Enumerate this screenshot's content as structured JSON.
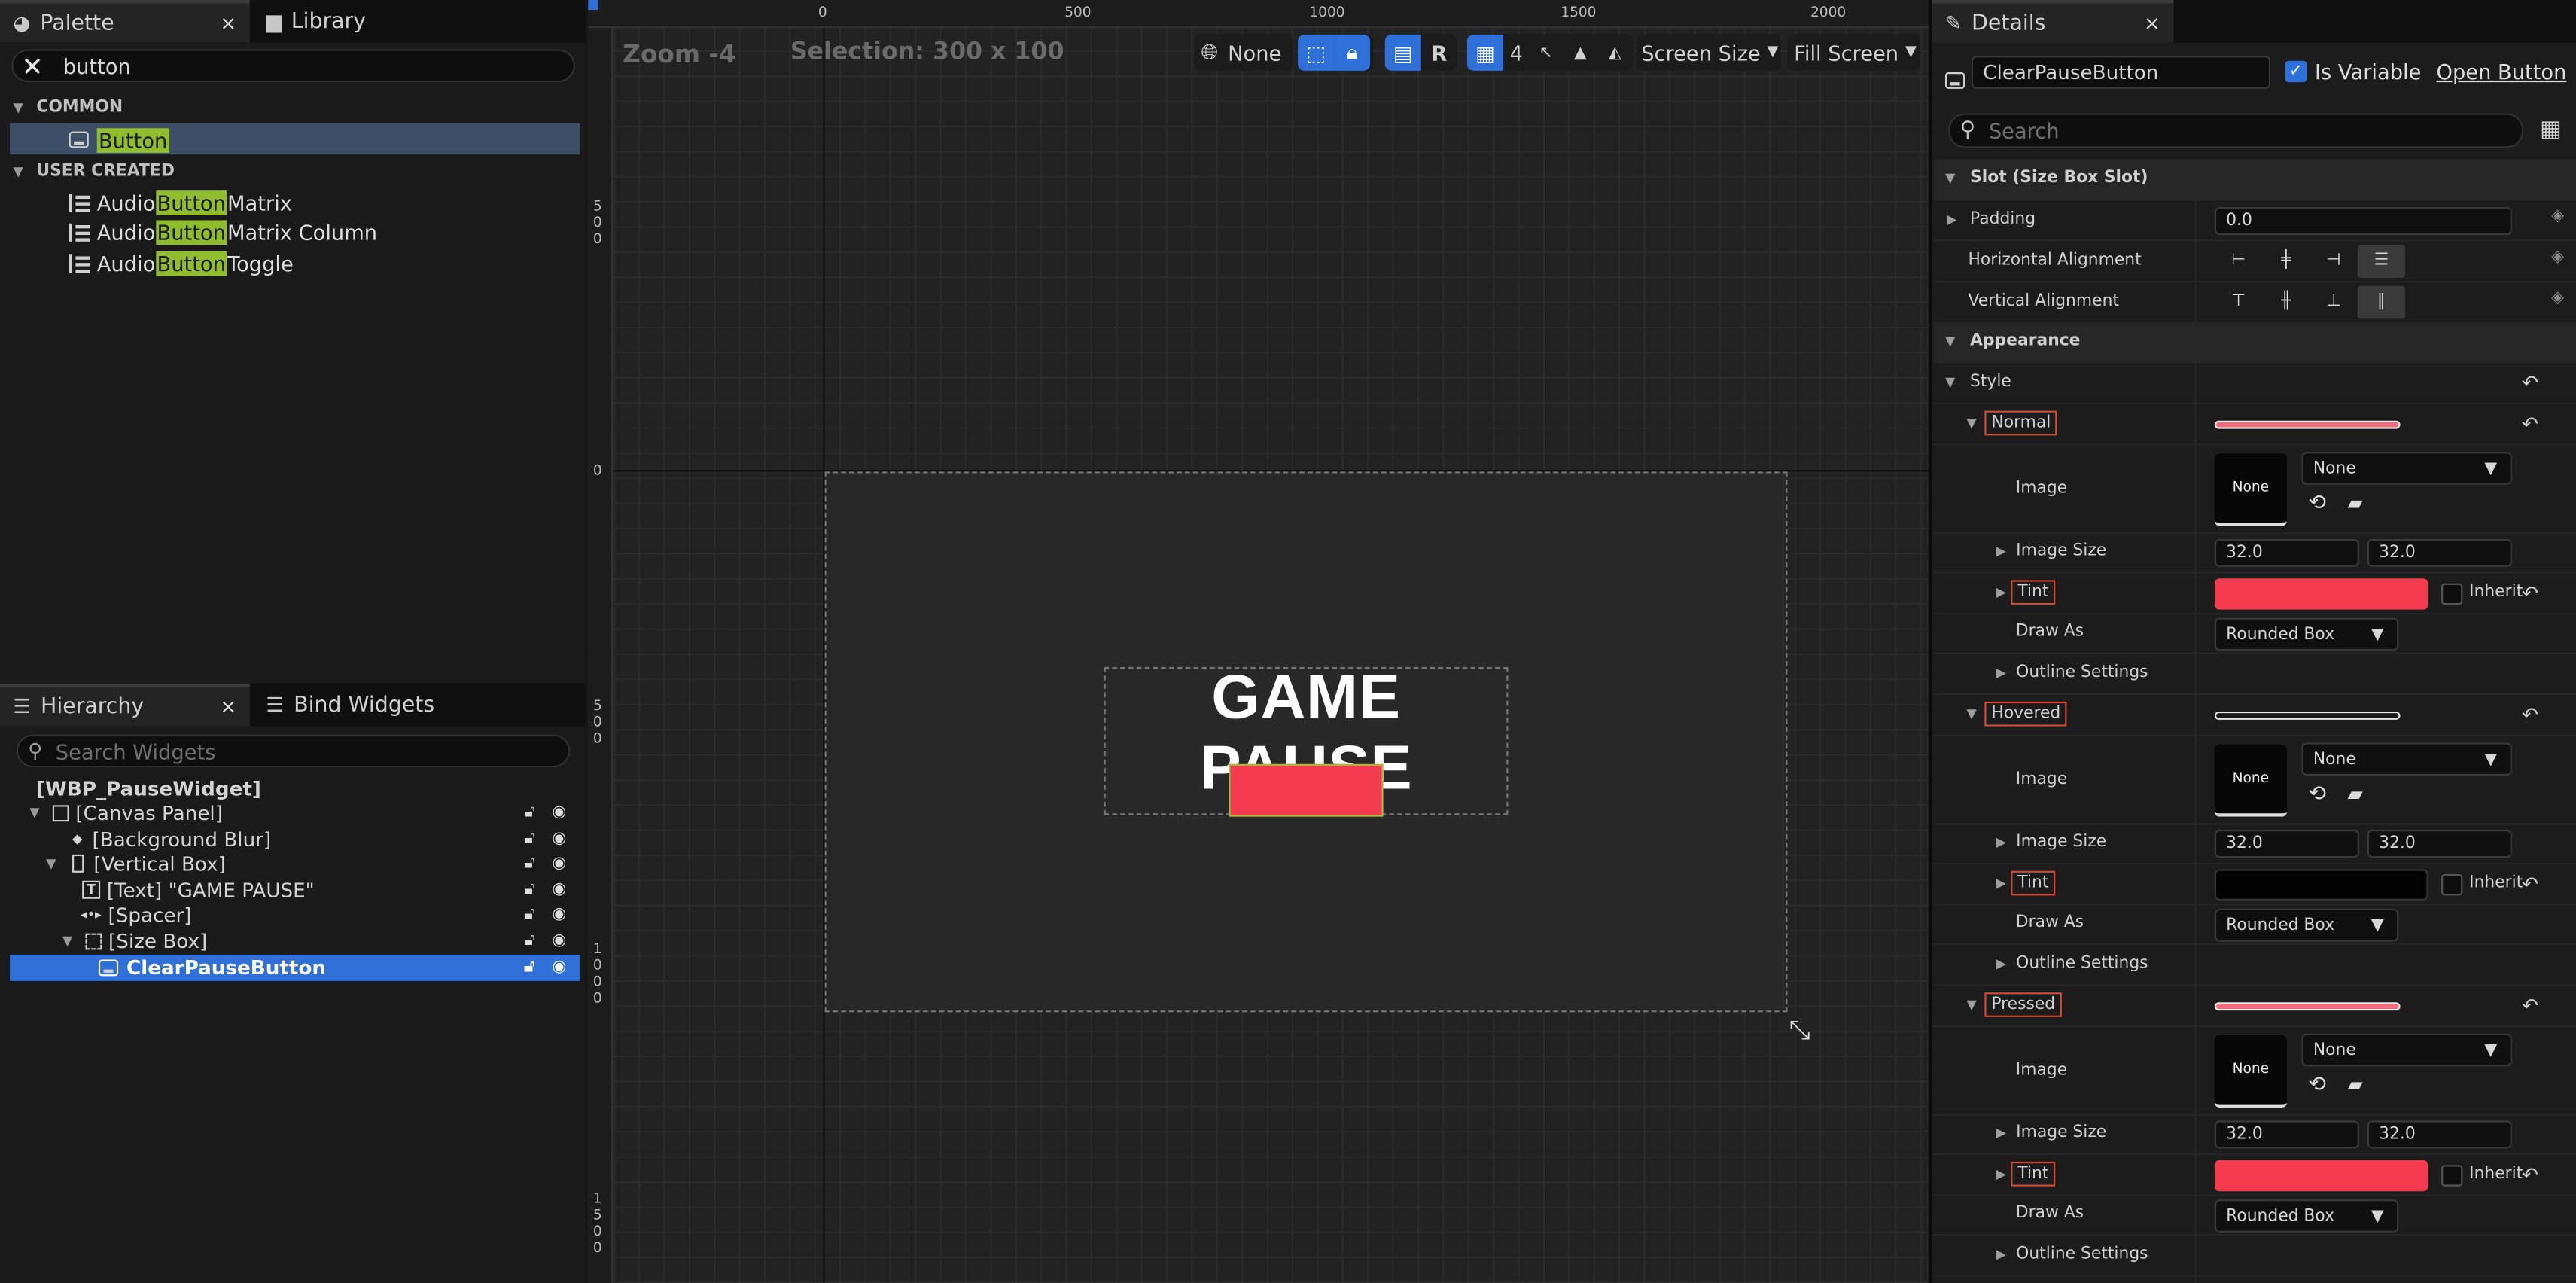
{
  "palette": {
    "tab_label": "Palette",
    "library_tab_label": "Library",
    "close_glyph": "×",
    "search_value": "button",
    "categories": [
      {
        "label": "COMMON",
        "items": [
          {
            "prefix": "",
            "match": "Button",
            "suffix": ""
          }
        ]
      },
      {
        "label": "USER CREATED",
        "items": [
          {
            "prefix": "Audio ",
            "match": "Button",
            "suffix": " Matrix"
          },
          {
            "prefix": "Audio ",
            "match": "Button",
            "suffix": " Matrix Column"
          },
          {
            "prefix": "Audio ",
            "match": "Button",
            "suffix": " Toggle"
          }
        ]
      }
    ]
  },
  "hierarchy": {
    "tab_label": "Hierarchy",
    "bind_tab_label": "Bind Widgets",
    "search_placeholder": "Search Widgets",
    "rows": [
      {
        "label": "[WBP_PauseWidget]"
      },
      {
        "label": "[Canvas Panel]"
      },
      {
        "label": "[Background Blur]"
      },
      {
        "label": "[Vertical Box]"
      },
      {
        "label": "[Text] \"GAME PAUSE\""
      },
      {
        "label": "[Spacer]"
      },
      {
        "label": "[Size Box]"
      },
      {
        "label": "ClearPauseButton"
      }
    ]
  },
  "designer": {
    "zoom_label": "Zoom -4",
    "selection_label": "Selection: 300 x 100",
    "toolbar": {
      "none_label": "None",
      "r_label": "R",
      "grid_value": "4",
      "screen_size_label": "Screen Size",
      "fill_screen_label": "Fill Screen"
    },
    "ruler_top_ticks": [
      "0",
      "500",
      "1000",
      "1500",
      "2000"
    ],
    "ruler_left_ticks": [
      "500",
      "0",
      "500",
      "1000",
      "1500"
    ],
    "game_title": "GAME PAUSE",
    "button_color": "#f43a4e"
  },
  "details": {
    "tab_label": "Details",
    "widget_name": "ClearPauseButton",
    "is_variable_label": "Is Variable",
    "open_button_label": "Open Button",
    "search_placeholder": "Search",
    "slot_section": "Slot (Size Box Slot)",
    "padding_label": "Padding",
    "padding_value": "0.0",
    "halign_label": "Horizontal Alignment",
    "valign_label": "Vertical Alignment",
    "appearance_section": "Appearance",
    "style_label": "Style",
    "states": [
      {
        "name": "Normal",
        "image_label": "Image",
        "thumb": "None",
        "image_value": "None",
        "size_label": "Image Size",
        "size_x": "32.0",
        "size_y": "32.0",
        "tint_label": "Tint",
        "tint_color": "#f43a4e",
        "inherit_label": "Inherit",
        "draw_as_label": "Draw As",
        "draw_as_value": "Rounded Box",
        "outline_label": "Outline Settings"
      },
      {
        "name": "Hovered",
        "image_label": "Image",
        "thumb": "None",
        "image_value": "None",
        "size_label": "Image Size",
        "size_x": "32.0",
        "size_y": "32.0",
        "tint_label": "Tint",
        "tint_color": "#030303",
        "inherit_label": "Inherit",
        "draw_as_label": "Draw As",
        "draw_as_value": "Rounded Box",
        "outline_label": "Outline Settings"
      },
      {
        "name": "Pressed",
        "image_label": "Image",
        "thumb": "None",
        "image_value": "None",
        "size_label": "Image Size",
        "size_x": "32.0",
        "size_y": "32.0",
        "tint_label": "Tint",
        "tint_color": "#f43a4e",
        "inherit_label": "Inherit",
        "draw_as_label": "Draw As",
        "draw_as_value": "Rounded Box",
        "outline_label": "Outline Settings"
      }
    ]
  }
}
